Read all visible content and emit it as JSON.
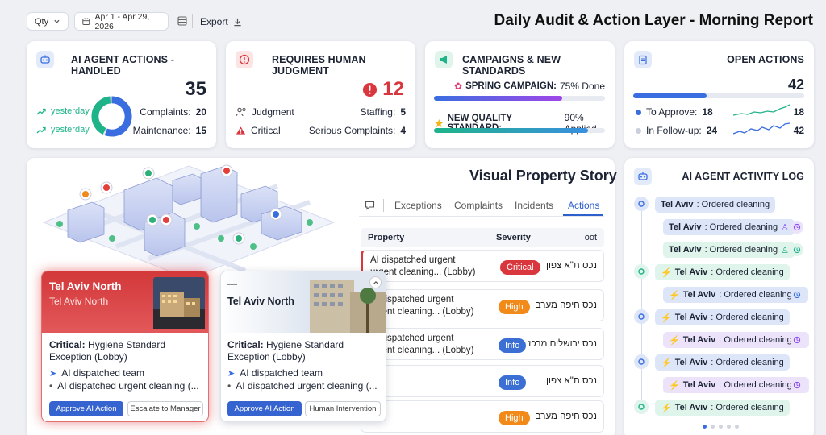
{
  "toolbar": {
    "qty_label": "Qty",
    "date_range": "Apr 1 - Apr 29, 2026",
    "export_label": "Export"
  },
  "page_title": "Daily Audit & Action Layer - Morning Report",
  "ai_actions": {
    "title": "AI AGENT ACTIONS - HANDLED",
    "total": "35",
    "trend1": "yesterday",
    "trend2": "yesterday",
    "complaints_label": "Complaints:",
    "complaints_value": "20",
    "maintenance_label": "Maintenance:",
    "maintenance_value": "15",
    "donut": {
      "complaints": 20,
      "maintenance": 15
    }
  },
  "judgment": {
    "title": "REQUIRES HUMAN JUDGMENT",
    "total": "12",
    "judgment_label": "Judgment",
    "staffing_label": "Staffing:",
    "staffing_value": "5",
    "critical_label": "Critical",
    "serious_label": "Serious Complaints:",
    "serious_value": "4"
  },
  "campaigns": {
    "title": "CAMPAIGNS & NEW STANDARDS",
    "spring_name": "SPRING CAMPAIGN:",
    "spring_status": "75% Done",
    "spring_progress": 0.75,
    "quality_name": "NEW QUALITY STANDARD:",
    "quality_status": "90% Applied",
    "quality_progress": 0.9
  },
  "open_actions": {
    "title": "OPEN ACTIONS",
    "total": "42",
    "approve_label": "To Approve:",
    "approve_value": "18",
    "approve_right": "18",
    "followup_label": "In Follow-up:",
    "followup_value": "24",
    "followup_right": "42",
    "approve_share": 0.43
  },
  "story": {
    "title": "Visual Property Story",
    "tabs": [
      "Exceptions",
      "Complaints",
      "Incidents",
      "Actions"
    ],
    "active_tab": "Actions",
    "columns": [
      "Property",
      "Severity",
      "oot"
    ],
    "rows": [
      {
        "line1": "AI dispatched urgent",
        "line2": "urgent cleaning... (Lobby)",
        "severity": "Critical",
        "hebrew": "נכס ת\"א צפון",
        "color": "#d9363e"
      },
      {
        "line1": "AI dispatched urgent",
        "line2": "urgent cleaning... (Lobby)",
        "severity": "High",
        "hebrew": "נכס חיפה מערב",
        "color": "#f28a1a"
      },
      {
        "line1": "AI dispatched urgent",
        "line2": "urgent cleaning... (Lobby)",
        "severity": "Info",
        "hebrew": "נכס ירושלים מרכז",
        "color": "#3b6fd4"
      },
      {
        "line1": "",
        "line2": "",
        "severity": "Info",
        "hebrew": "נכס ת\"א צפון",
        "color": "#3b6fd4"
      },
      {
        "line1": "",
        "line2": "",
        "severity": "High",
        "hebrew": "נכס חיפה מערב",
        "color": "#f28a1a"
      }
    ]
  },
  "popup1": {
    "title": "Tel Aviv North",
    "subtitle": "Tel Aviv North",
    "critical_label": "Critical:",
    "critical_text": "Hygiene Standard",
    "critical_text2": "Exception (Lobby)",
    "line1": "AI dispatched team",
    "line2": "AI dispatched urgent cleaning (...",
    "approve_btn": "Approve AI Action",
    "escalate_btn": "Escalate to Manager"
  },
  "popup2": {
    "dash": "—",
    "title": "Tel Aviv North",
    "critical_label": "Critical:",
    "critical_text": "Hygiene Standard",
    "critical_text2": "Exception (Lobby)",
    "line1": "AI dispatched team",
    "line2": "AI dispatched urgent cleaning (...",
    "approve_btn": "Approve AI Action",
    "human_btn": "Human Intervention"
  },
  "activity_log": {
    "title": "AI AGENT ACTIVITY LOG",
    "items": [
      {
        "city": "Tel Aviv",
        "text": ": Ordered cleaning"
      },
      {
        "city": "Tel Aviv",
        "text": ": Ordered cleaning"
      },
      {
        "city": "Tel Aviv",
        "text": ": Ordered cleaning"
      },
      {
        "city": "Tel Aviv",
        "text": ": Ordered cleaning"
      },
      {
        "city": "Tel Aviv",
        "text": ": Ordered cleaning"
      },
      {
        "city": "Tel Aviv",
        "text": ": Ordered cleaning"
      },
      {
        "city": "Tel Aviv",
        "text": ": Ordered cleaning"
      },
      {
        "city": "Tel Aviv",
        "text": ": Ordered cleaning"
      },
      {
        "city": "Tel Aviv",
        "text": ": Ordered cleaning"
      }
    ]
  },
  "colors": {
    "teal": "#1fb38a",
    "blue": "#3a6ee0",
    "critical": "#d9363e",
    "high": "#f28a1a",
    "info": "#3b6fd4",
    "purple": "#8a4ff0"
  }
}
